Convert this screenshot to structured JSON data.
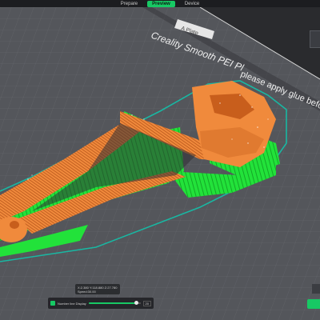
{
  "tabs": [
    {
      "label": "Prepare",
      "active": false
    },
    {
      "label": "Preview",
      "active": true
    },
    {
      "label": "Device",
      "active": false
    }
  ],
  "plate": {
    "label": "A Plate",
    "bed_text_1": "Creality Smooth PEI Pl",
    "bed_text_2": "please apply glue befo"
  },
  "coords": {
    "line1": "X:2.380 Y:118.880 Z:27.780",
    "line2": "Speed:30.00"
  },
  "slider": {
    "label": "Number line Display",
    "value": "20",
    "fill": 0.92
  },
  "colors": {
    "accent": "#17c964",
    "model_top": "#f08a3c",
    "model_dark": "#c85e1c",
    "support": "#22e23a",
    "bed": "#54565b",
    "grid": "#6a6c71"
  }
}
